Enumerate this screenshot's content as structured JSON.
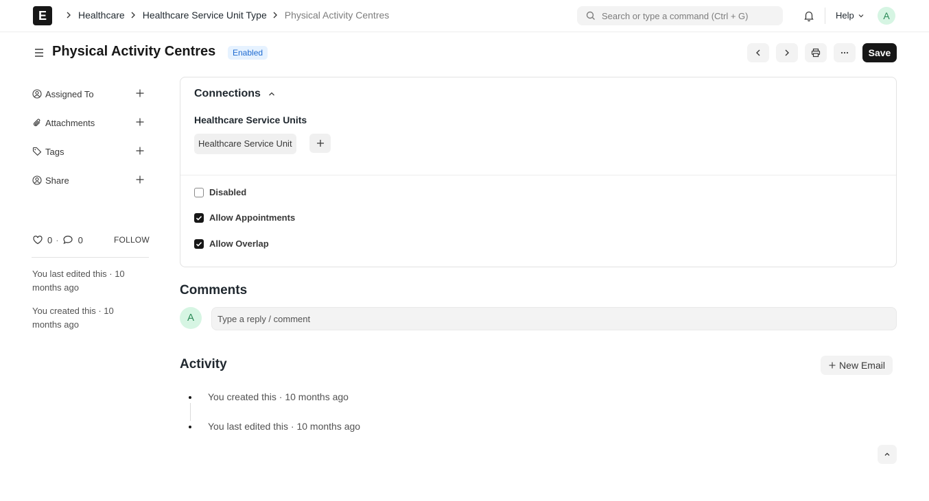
{
  "navbar": {
    "logo": "E",
    "breadcrumbs": [
      "Healthcare",
      "Healthcare Service Unit Type",
      "Physical Activity Centres"
    ],
    "search_placeholder": "Search or type a command (Ctrl + G)",
    "help_label": "Help",
    "avatar_initial": "A"
  },
  "header": {
    "title": "Physical Activity Centres",
    "status": "Enabled",
    "save_label": "Save",
    "status_color": "#e6f2ff"
  },
  "sidebar": {
    "items": [
      {
        "label": "Assigned To",
        "icon": "assign-user-icon"
      },
      {
        "label": "Attachments",
        "icon": "paperclip-icon"
      },
      {
        "label": "Tags",
        "icon": "tag-icon"
      },
      {
        "label": "Share",
        "icon": "share-user-icon"
      }
    ],
    "likes": "0",
    "comments": "0",
    "follow_label": "FOLLOW",
    "last_edited": "You last edited this · 10 months ago",
    "created": "You created this · 10 months ago"
  },
  "connections": {
    "title": "Connections",
    "group_title": "Healthcare Service Units",
    "link_label": "Healthcare Service Unit"
  },
  "fields": [
    {
      "label": "Disabled",
      "checked": false
    },
    {
      "label": "Allow Appointments",
      "checked": true
    },
    {
      "label": "Allow Overlap",
      "checked": true
    }
  ],
  "comments": {
    "title": "Comments",
    "avatar_initial": "A",
    "placeholder": "Type a reply / comment"
  },
  "activity": {
    "title": "Activity",
    "new_email_label": "New Email",
    "items": [
      "You created this · 10 months ago",
      "You last edited this · 10 months ago"
    ]
  }
}
